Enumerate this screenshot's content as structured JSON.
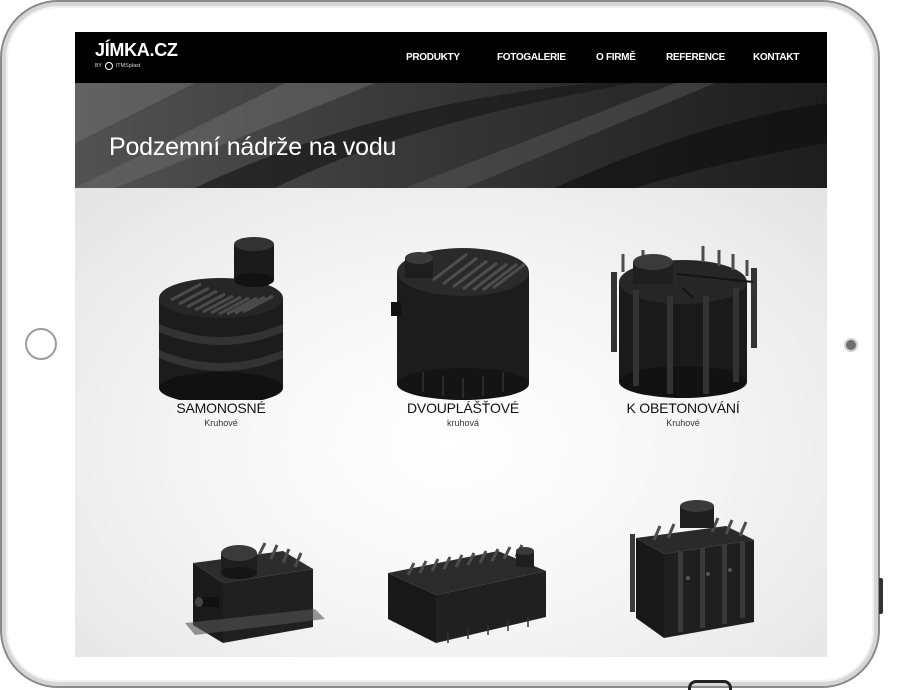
{
  "site": {
    "logo": "JÍMKA.CZ",
    "logo_by": "BY",
    "logo_brand": "ITMSplast"
  },
  "nav": {
    "items": [
      {
        "label": "PRODUKTY"
      },
      {
        "label": "FOTOGALERIE"
      },
      {
        "label": "O FIRMĚ"
      },
      {
        "label": "REFERENCE"
      },
      {
        "label": "KONTAKT"
      }
    ]
  },
  "hero": {
    "title": "Podzemní nádrže na vodu"
  },
  "products": [
    {
      "title": "SAMONOSNÉ",
      "subtitle": "Kruhové",
      "icon": "self-supporting-round-tank-image"
    },
    {
      "title": "DVOUPLÁŠŤOVÉ",
      "subtitle": "kruhová",
      "icon": "double-wall-round-tank-image"
    },
    {
      "title": "K OBETONOVÁNÍ",
      "subtitle": "Kruhové",
      "icon": "concrete-encased-round-tank-image"
    },
    {
      "title": "",
      "subtitle": "",
      "icon": "rectangular-tank-with-dome-image"
    },
    {
      "title": "",
      "subtitle": "",
      "icon": "rectangular-ribbed-tank-image"
    },
    {
      "title": "",
      "subtitle": "",
      "icon": "tall-rectangular-tank-image"
    }
  ],
  "colors": {
    "navbar": "#000000",
    "tank": "#1a1a1a",
    "content_bg": "#f5f5f5"
  }
}
